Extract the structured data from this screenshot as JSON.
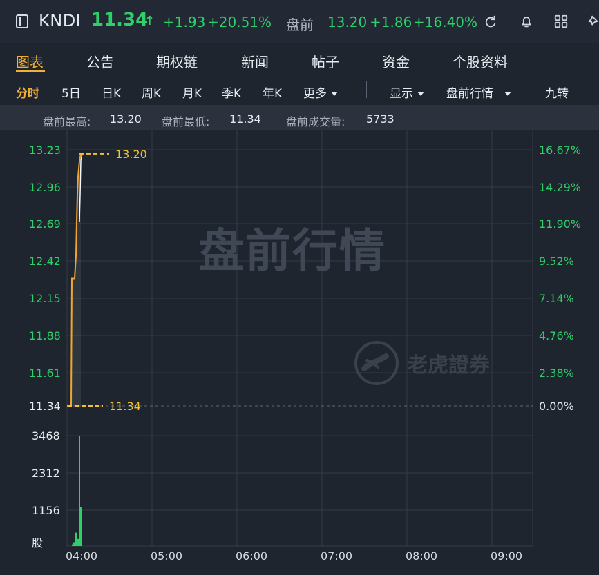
{
  "header": {
    "ticker": "KNDI",
    "price": "11.34",
    "arrow": "↑",
    "change": "+1.93",
    "change_pct": "+20.51%",
    "premarket_label": "盘前",
    "premarket_price": "13.20",
    "premarket_change": "+1.86",
    "premarket_change_pct": "+16.40%"
  },
  "tabs": [
    {
      "label": "图表"
    },
    {
      "label": "公告"
    },
    {
      "label": "期权链"
    },
    {
      "label": "新闻"
    },
    {
      "label": "帖子"
    },
    {
      "label": "资金"
    },
    {
      "label": "个股资料"
    }
  ],
  "toolbar": {
    "items": [
      {
        "label": "分时"
      },
      {
        "label": "5日"
      },
      {
        "label": "日K"
      },
      {
        "label": "周K"
      },
      {
        "label": "月K"
      },
      {
        "label": "季K"
      },
      {
        "label": "年K"
      },
      {
        "label": "更多"
      }
    ],
    "right_items": [
      {
        "label": "显示"
      },
      {
        "label": "盘前行情"
      },
      {
        "label": "九转"
      }
    ]
  },
  "stats": {
    "high_label": "盘前最高:",
    "high_value": "13.20",
    "low_label": "盘前最低:",
    "low_value": "11.34",
    "volume_label": "盘前成交量:",
    "volume_value": "5733"
  },
  "chart_overlay": {
    "watermark": "盘前行情",
    "brand": "老虎證券",
    "high_marker": "13.20",
    "low_marker": "11.34"
  },
  "chart_data": {
    "type": "line",
    "left_ticks": [
      "13.23",
      "12.96",
      "12.69",
      "12.42",
      "12.15",
      "11.88",
      "11.61",
      "11.34"
    ],
    "right_ticks": [
      "16.67%",
      "14.29%",
      "11.90%",
      "9.52%",
      "7.14%",
      "4.76%",
      "2.38%",
      "0.00%"
    ],
    "volume_ticks": [
      "3468",
      "2312",
      "1156",
      "股"
    ],
    "x_ticks": [
      "04:00",
      "05:00",
      "06:00",
      "07:00",
      "08:00",
      "09:00"
    ],
    "price_series": {
      "x": [
        "04:00",
        "04:00",
        "04:00",
        "04:00",
        "04:00",
        "04:00",
        "04:00",
        "04:00",
        "04:00",
        "04:00"
      ],
      "y": [
        11.34,
        11.34,
        12.28,
        12.28,
        12.45,
        12.7,
        12.9,
        13.03,
        13.15,
        13.2
      ]
    },
    "volume_bars": [
      {
        "x": "04:00",
        "value": 50
      },
      {
        "x": "04:00",
        "value": 120
      },
      {
        "x": "04:00",
        "value": 420
      },
      {
        "x": "04:00",
        "value": 220
      },
      {
        "x": "04:00",
        "value": 3468
      },
      {
        "x": "04:00",
        "value": 1230
      }
    ],
    "ylim": [
      11.34,
      13.23
    ],
    "grid": true
  }
}
